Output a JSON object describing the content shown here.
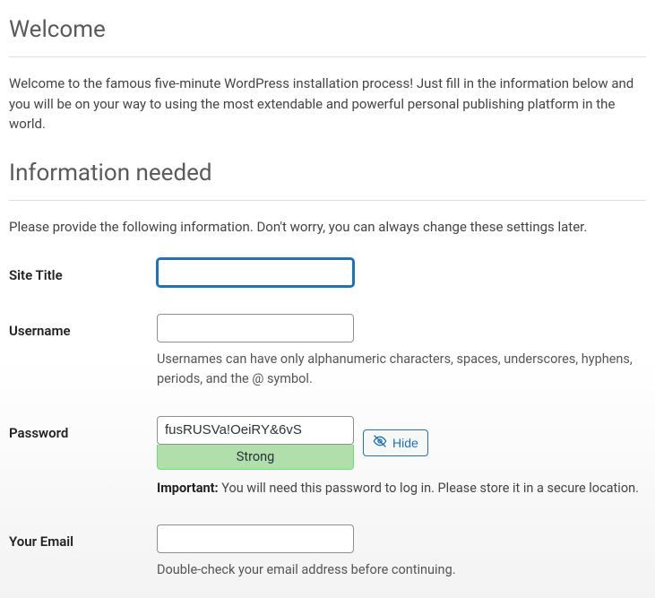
{
  "welcome": {
    "heading": "Welcome",
    "intro": "Welcome to the famous five-minute WordPress installation process! Just fill in the information below and you will be on your way to using the most extendable and powerful personal publishing platform in the world."
  },
  "info": {
    "heading": "Information needed",
    "intro": "Please provide the following information. Don't worry, you can always change these settings later."
  },
  "fields": {
    "site_title": {
      "label": "Site Title",
      "value": ""
    },
    "username": {
      "label": "Username",
      "value": "",
      "hint": "Usernames can have only alphanumeric characters, spaces, underscores, hyphens, periods, and the @ symbol."
    },
    "password": {
      "label": "Password",
      "value": "fusRUSVa!OeiRY&6vS",
      "strength": "Strong",
      "hide_button": "Hide",
      "important_label": "Important:",
      "important_text": " You will need this password to log in. Please store it in a secure location."
    },
    "email": {
      "label": "Your Email",
      "value": "",
      "hint": "Double-check your email address before continuing."
    }
  }
}
